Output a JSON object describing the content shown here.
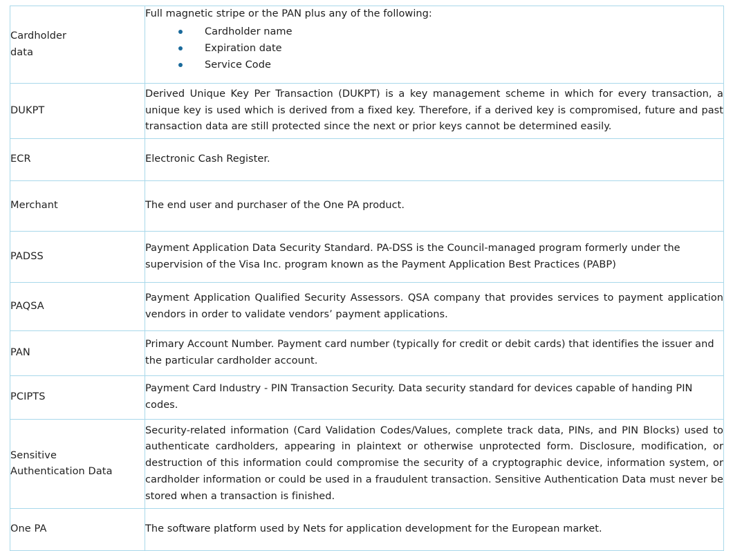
{
  "document": {
    "type": "glossary-table",
    "colors": {
      "border": "#a8d8ea",
      "bullet": "#1a6a9b",
      "text": "#1d1d1d",
      "background": "#ffffff"
    }
  },
  "table": {
    "rows": [
      {
        "term": "Cardholder\ndata",
        "term_line1": "Cardholder",
        "term_line2": "data",
        "intro": "Full magnetic stripe or the PAN plus any of the following:",
        "bullets": [
          "Cardholder name",
          "Expiration date",
          "Service Code"
        ]
      },
      {
        "term": "DUKPT",
        "definition": "Derived Unique Key Per Transaction (DUKPT) is a key management scheme in which for every transaction, a unique key is used which is derived from a fixed key. Therefore, if a derived key is compromised, future and past transaction data are still protected since the next or prior keys cannot be determined easily."
      },
      {
        "term": "ECR",
        "definition": "Electronic Cash Register."
      },
      {
        "term": "Merchant",
        "definition": "The end user and purchaser of the One PA product."
      },
      {
        "term": "PADSS",
        "definition": "Payment Application Data Security Standard. PA-DSS is the Council-managed program formerly under the supervision of the Visa Inc. program known as the Payment Application Best Practices (PABP)"
      },
      {
        "term": "PAQSA",
        "definition": "Payment Application Qualified Security Assessors. QSA company that provides services to payment application vendors in order to validate vendors’ payment applications."
      },
      {
        "term": "PAN",
        "definition": "Primary Account Number. Payment card number (typically for credit or debit cards) that identifies the issuer and the particular cardholder account."
      },
      {
        "term": "PCIPTS",
        "definition": "Payment Card Industry - PIN Transaction Security. Data security standard for devices capable of handing PIN codes."
      },
      {
        "term": "Sensitive\nAuthentication Data",
        "term_line1": "Sensitive",
        "term_line2": "Authentication Data",
        "definition": "Security-related information (Card Validation Codes/Values, complete track data, PINs, and PIN Blocks) used to authenticate cardholders, appearing in plaintext or otherwise unprotected form. Disclosure, modification, or destruction of this information could compromise the security of a cryptographic device, information system, or cardholder information or could be used in a fraudulent transaction. Sensitive Authentication Data must never be stored when a transaction is finished."
      },
      {
        "term": "One PA",
        "definition": "The software platform used by Nets for application development for the European market."
      }
    ]
  }
}
